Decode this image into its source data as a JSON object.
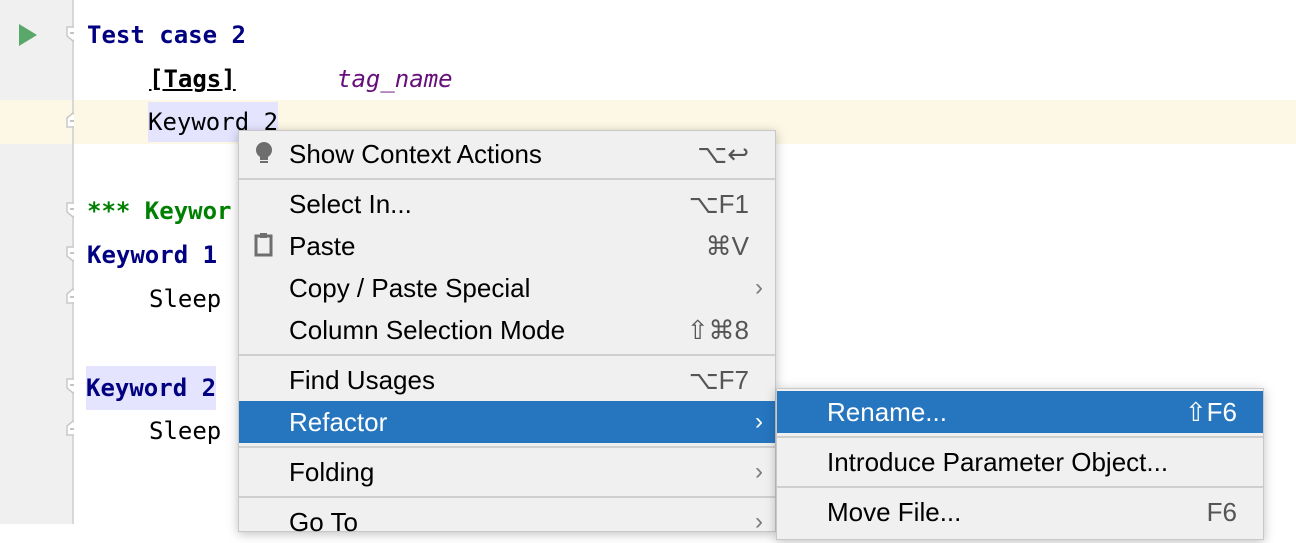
{
  "editor": {
    "lines": [
      {
        "text": "Test case 2",
        "style": "keyword-definition"
      },
      {
        "label": "[Tags]",
        "value": "tag_name"
      },
      {
        "text": "Keyword 2",
        "style": "plain-highlight"
      },
      {
        "text": "*** Keywor",
        "style": "section"
      },
      {
        "text": "Keyword 1",
        "style": "keyword-definition"
      },
      {
        "text": "Sleep",
        "style": "plain"
      },
      {
        "text": "Keyword 2",
        "style": "keyword-definition-highlight"
      },
      {
        "text": "Sleep",
        "style": "plain"
      }
    ]
  },
  "context_menu": {
    "items": [
      {
        "label": "Show Context Actions",
        "shortcut": "⌥↩",
        "icon": "lightbulb-icon"
      },
      {
        "label": "Select In...",
        "shortcut": "⌥F1"
      },
      {
        "label": "Paste",
        "shortcut": "⌘V",
        "icon": "clipboard-icon"
      },
      {
        "label": "Copy / Paste Special",
        "submenu": true
      },
      {
        "label": "Column Selection Mode",
        "shortcut": "⇧⌘8"
      },
      {
        "label": "Find Usages",
        "shortcut": "⌥F7"
      },
      {
        "label": "Refactor",
        "submenu": true,
        "selected": true
      },
      {
        "label": "Folding",
        "submenu": true
      },
      {
        "label": "Go To",
        "submenu": true
      }
    ],
    "arrow": "›"
  },
  "refactor_submenu": {
    "items": [
      {
        "label": "Rename...",
        "shortcut": "⇧F6",
        "selected": true
      },
      {
        "label": "Introduce Parameter Object..."
      },
      {
        "label": "Move File...",
        "shortcut": "F6"
      }
    ]
  },
  "colors": {
    "selection": "#2675bf",
    "run": "#59a869",
    "keyword": "#000080",
    "section": "#008000",
    "tag": "#660e7a"
  }
}
